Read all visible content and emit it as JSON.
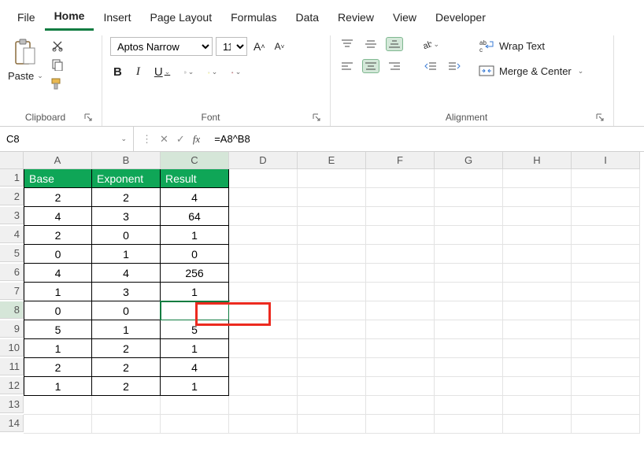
{
  "menu": [
    "File",
    "Home",
    "Insert",
    "Page Layout",
    "Formulas",
    "Data",
    "Review",
    "View",
    "Developer"
  ],
  "menu_active": "Home",
  "clipboard": {
    "paste": "Paste",
    "label": "Clipboard"
  },
  "font": {
    "name": "Aptos Narrow",
    "size": "11",
    "grow": "A^",
    "shrink": "A˅",
    "bold": "B",
    "italic": "I",
    "underline": "U",
    "label": "Font"
  },
  "alignment": {
    "wrap": "Wrap Text",
    "merge": "Merge & Center",
    "label": "Alignment"
  },
  "namebox": "C8",
  "formula": "=A8^B8",
  "columns": [
    "A",
    "B",
    "C",
    "D",
    "E",
    "F",
    "G",
    "H",
    "I"
  ],
  "rows": [
    "1",
    "2",
    "3",
    "4",
    "5",
    "6",
    "7",
    "8",
    "9",
    "10",
    "11",
    "12",
    "13",
    "14"
  ],
  "headers": [
    "Base",
    "Exponent",
    "Result"
  ],
  "data": [
    [
      "2",
      "2",
      "4"
    ],
    [
      "4",
      "3",
      "64"
    ],
    [
      "2",
      "0",
      "1"
    ],
    [
      "0",
      "1",
      "0"
    ],
    [
      "4",
      "4",
      "256"
    ],
    [
      "1",
      "3",
      "1"
    ],
    [
      "0",
      "0",
      ""
    ],
    [
      "5",
      "1",
      "5"
    ],
    [
      "1",
      "2",
      "1"
    ],
    [
      "2",
      "2",
      "4"
    ],
    [
      "1",
      "2",
      "1"
    ]
  ],
  "selected_cell": {
    "row": 8,
    "col": "C"
  }
}
